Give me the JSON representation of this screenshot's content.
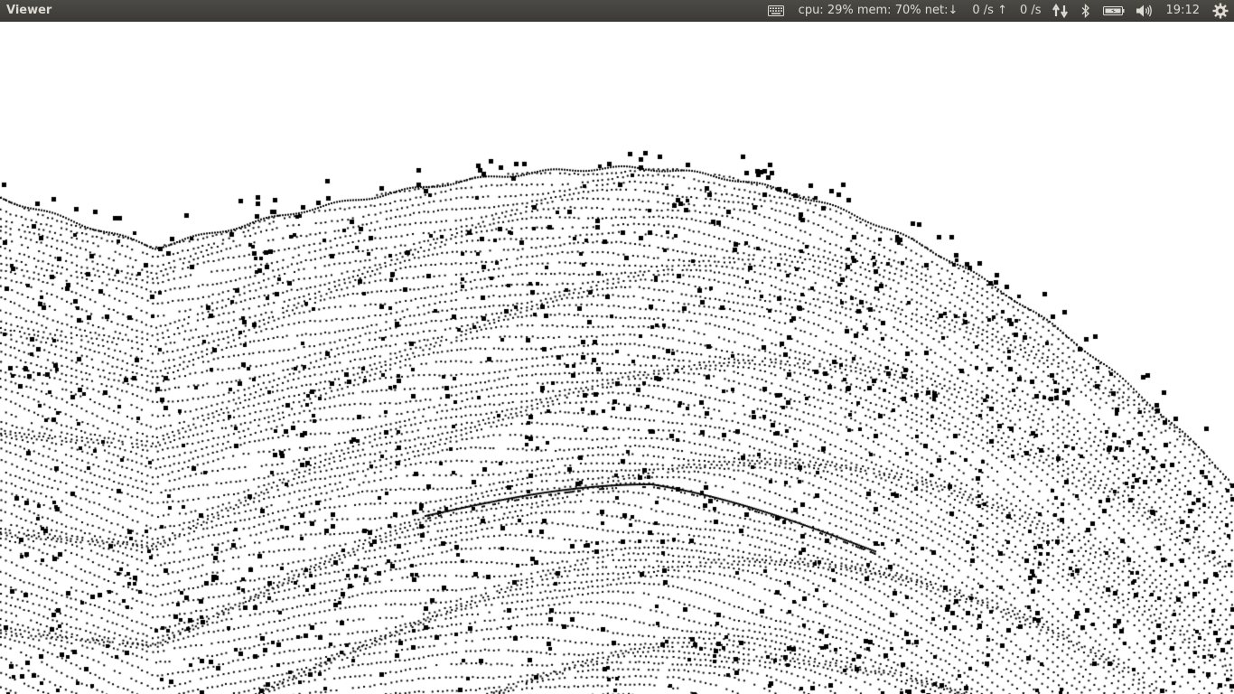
{
  "panel": {
    "app_title": "Viewer",
    "keyboard_icon": "keyboard-icon",
    "sysmon": {
      "cpu": "cpu: 29%",
      "mem": "mem: 70%",
      "net": "net:",
      "down_arrow": "↓",
      "down_rate": "0 /s",
      "up_arrow": "↑",
      "up_rate": "0 /s"
    },
    "network_icon": "network-updown-icon",
    "bluetooth_icon": "bluetooth-icon",
    "battery_icon": "battery-icon",
    "volume_icon": "volume-icon",
    "clock": "19:12",
    "session_icon": "gear-icon",
    "text_color": "#dfdbd2",
    "background_color": "#3c3b37"
  },
  "viewer": {
    "background_color": "#ffffff",
    "point_color": "#000000",
    "content": "point-cloud"
  }
}
